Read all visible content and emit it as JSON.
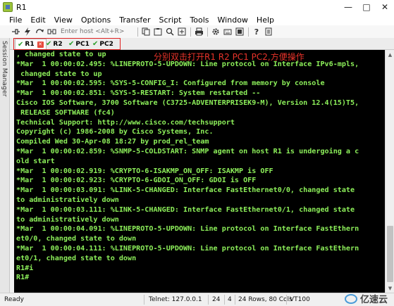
{
  "window": {
    "title": "R1",
    "controls": [
      "—",
      "□",
      "✕"
    ]
  },
  "menu": [
    "File",
    "Edit",
    "View",
    "Options",
    "Transfer",
    "Script",
    "Tools",
    "Window",
    "Help"
  ],
  "toolbar": {
    "icons_left": [
      "connect-icon",
      "lightning-icon",
      "reconnect-icon",
      "disconnect-icon"
    ],
    "host_placeholder": "Enter host <Alt+R>",
    "icons_right": [
      "copy-icon",
      "paste-icon",
      "find-icon",
      "transfer-icon",
      "print-icon",
      "settings-icon",
      "keymap-icon",
      "sftp-icon",
      "help-icon",
      "extra-icon"
    ]
  },
  "side_panel": {
    "label": "Session Manager"
  },
  "tabs": [
    {
      "label": "R1",
      "active": true
    },
    {
      "label": "R2",
      "active": false
    },
    {
      "label": "PC1",
      "active": false
    },
    {
      "label": "PC2",
      "active": false
    }
  ],
  "annotation": "分别双击打开R1 R2 PC1 PC2,方便操作",
  "terminal_lines": [
    ", changed state to up",
    "*Mar  1 00:00:02.495: %LINEPROTO-5-UPDOWN: Line protocol on Interface IPv6-mpls,",
    " changed state to up",
    "*Mar  1 00:00:02.595: %SYS-5-CONFIG_I: Configured from memory by console",
    "*Mar  1 00:00:02.851: %SYS-5-RESTART: System restarted --",
    "Cisco IOS Software, 3700 Software (C3725-ADVENTERPRISEK9-M), Version 12.4(15)T5,",
    " RELEASE SOFTWARE (fc4)",
    "Technical Support: http://www.cisco.com/techsupport",
    "Copyright (c) 1986-2008 by Cisco Systems, Inc.",
    "Compiled Wed 30-Apr-08 18:27 by prod_rel_team",
    "*Mar  1 00:00:02.859: %SNMP-5-COLDSTART: SNMP agent on host R1 is undergoing a c",
    "old start",
    "*Mar  1 00:00:02.919: %CRYPTO-6-ISAKMP_ON_OFF: ISAKMP is OFF",
    "*Mar  1 00:00:02.923: %CRYPTO-6-GDOI_ON_OFF: GDOI is OFF",
    "*Mar  1 00:00:03.091: %LINK-5-CHANGED: Interface FastEthernet0/0, changed state",
    "to administratively down",
    "*Mar  1 00:00:03.111: %LINK-5-CHANGED: Interface FastEthernet0/1, changed state",
    "to administratively down",
    "*Mar  1 00:00:04.091: %LINEPROTO-5-UPDOWN: Line protocol on Interface FastEthern",
    "et0/0, changed state to down",
    "*Mar  1 00:00:04.111: %LINEPROTO-5-UPDOWN: Line protocol on Interface FastEthern",
    "et0/1, changed state to down",
    "R1#i",
    "R1#"
  ],
  "statusbar": {
    "status": "Ready",
    "connection": "Telnet: 127.0.0.1",
    "cursor_row": "24",
    "cursor_col": "4",
    "dimensions": "24 Rows, 80 Cols",
    "terminal_type": "VT100"
  },
  "watermark": {
    "text": "亿速云"
  },
  "colors": {
    "terminal_bg": "#000000",
    "terminal_fg": "#8df05a",
    "highlight": "#e02020",
    "tab_check": "#2ea02e"
  }
}
